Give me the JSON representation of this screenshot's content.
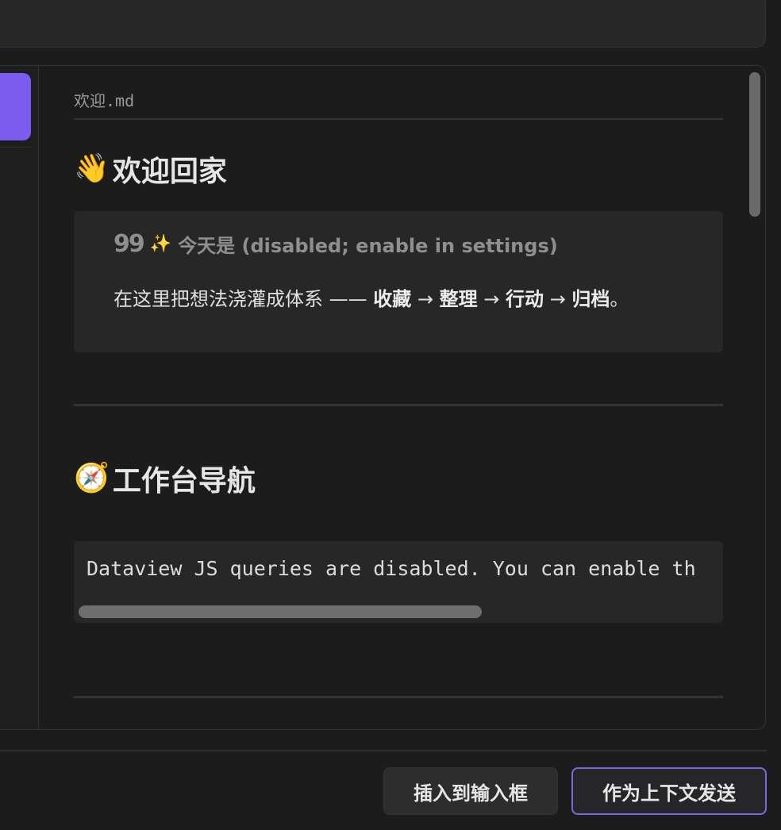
{
  "document": {
    "file_name": "欢迎.md",
    "welcome_heading": {
      "icon": "waving-hand-icon",
      "icon_glyph": "👋",
      "text": "欢迎回家"
    },
    "callout": {
      "quote_icon": "quote-icon",
      "quote_glyph": "99",
      "sparkle_icon": "sparkles-icon",
      "sparkle_glyph": "✨",
      "title": "今天是 (disabled; enable in settings)",
      "body_prefix": "在这里把想法浇灌成体系 —— ",
      "body_steps": [
        "收藏",
        "整理",
        "行动",
        "归档"
      ],
      "step_arrow": " → ",
      "body_suffix": "。"
    },
    "nav_heading": {
      "icon": "compass-icon",
      "icon_glyph": "🧭",
      "text": "工作台导航"
    },
    "code_block": {
      "text": "Dataview JS queries are disabled. You can enable th"
    }
  },
  "footer": {
    "insert_button": "插入到输入框",
    "send_button": "作为上下文发送"
  },
  "colors": {
    "accent": "#7b5cf0",
    "background": "#1c1c1c",
    "surface": "#272727"
  }
}
